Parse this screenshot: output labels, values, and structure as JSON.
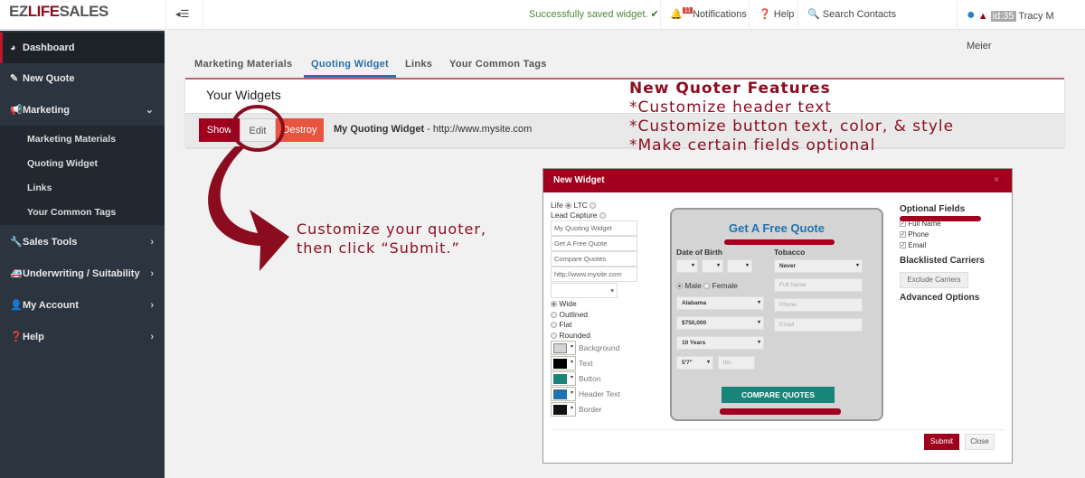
{
  "header": {
    "logo_a": "EZ",
    "logo_b": "LIFE",
    "logo_c": "SALES",
    "status": "Successfully saved widget.",
    "notif_count": "11",
    "notifications": "Notifications",
    "help": "Help",
    "search": "Search Contacts",
    "user_id": "id:35",
    "user_name": "Tracy M Meier"
  },
  "sidebar": {
    "items": [
      {
        "label": "Dashboard",
        "icon": "dashboard-icon"
      },
      {
        "label": "New Quote",
        "icon": "pencil-icon"
      },
      {
        "label": "Marketing",
        "icon": "bullhorn-icon"
      },
      {
        "label": "Sales Tools",
        "icon": "wrench-icon"
      },
      {
        "label": "Underwriting / Suitability",
        "icon": "ambulance-icon"
      },
      {
        "label": "My Account",
        "icon": "user-icon"
      },
      {
        "label": "Help",
        "icon": "question-icon"
      }
    ],
    "sub": [
      "Marketing Materials",
      "Quoting Widget",
      "Links",
      "Your Common Tags"
    ]
  },
  "tabs": [
    "Marketing Materials",
    "Quoting Widget",
    "Links",
    "Your Common Tags"
  ],
  "active_tab": "Quoting Widget",
  "panel": {
    "title": "Your Widgets",
    "show": "Show",
    "edit": "Edit",
    "destroy": "Destroy",
    "widget_name": "My Quoting Widget",
    "widget_url": " - http://www.mysite.com"
  },
  "annotation": {
    "features": [
      "New Quoter Features",
      "*Customize header text",
      "*Customize button text, color, & style",
      "*Make certain fields optional"
    ],
    "customize": [
      "Customize your quoter,",
      "then click “Submit.”"
    ],
    "color": "#8b0c1e"
  },
  "modal": {
    "title": "New Widget",
    "type_life": "Life",
    "type_ltc": "LTC",
    "type_lead": "Lead Capture",
    "fields": [
      "My Quoting Widget",
      "Get A Free Quote",
      "Compare Quotes",
      "http://www.mysite.com"
    ],
    "styles": [
      "Wide",
      "Outlined",
      "Flat",
      "Rounded"
    ],
    "colors": [
      {
        "label": "Background",
        "value": "#d4d4d4"
      },
      {
        "label": "Text",
        "value": "#000000"
      },
      {
        "label": "Button",
        "value": "#17857a"
      },
      {
        "label": "Header Text",
        "value": "#1f73ad"
      },
      {
        "label": "Border",
        "value": "#111111"
      }
    ],
    "preview": {
      "title": "Get A Free Quote",
      "dob": "Date of Birth",
      "tobacco": "Tobacco",
      "tobacco_val": "Never",
      "male": "Male",
      "female": "Female",
      "state": "Alabama",
      "amount": "$750,000",
      "term": "10 Years",
      "height": "5'7\"",
      "weight_ph": "lbs.",
      "name_ph": "Full Name",
      "phone_ph": "Phone",
      "email_ph": "Email",
      "button": "COMPARE QUOTES"
    },
    "optional_title": "Optional Fields",
    "optional": [
      "Full Name",
      "Phone",
      "Email"
    ],
    "blacklist_title": "Blacklisted Carriers",
    "exclude": "Exclude Carriers",
    "advanced": "Advanced Options",
    "submit": "Submit",
    "close": "Close"
  }
}
